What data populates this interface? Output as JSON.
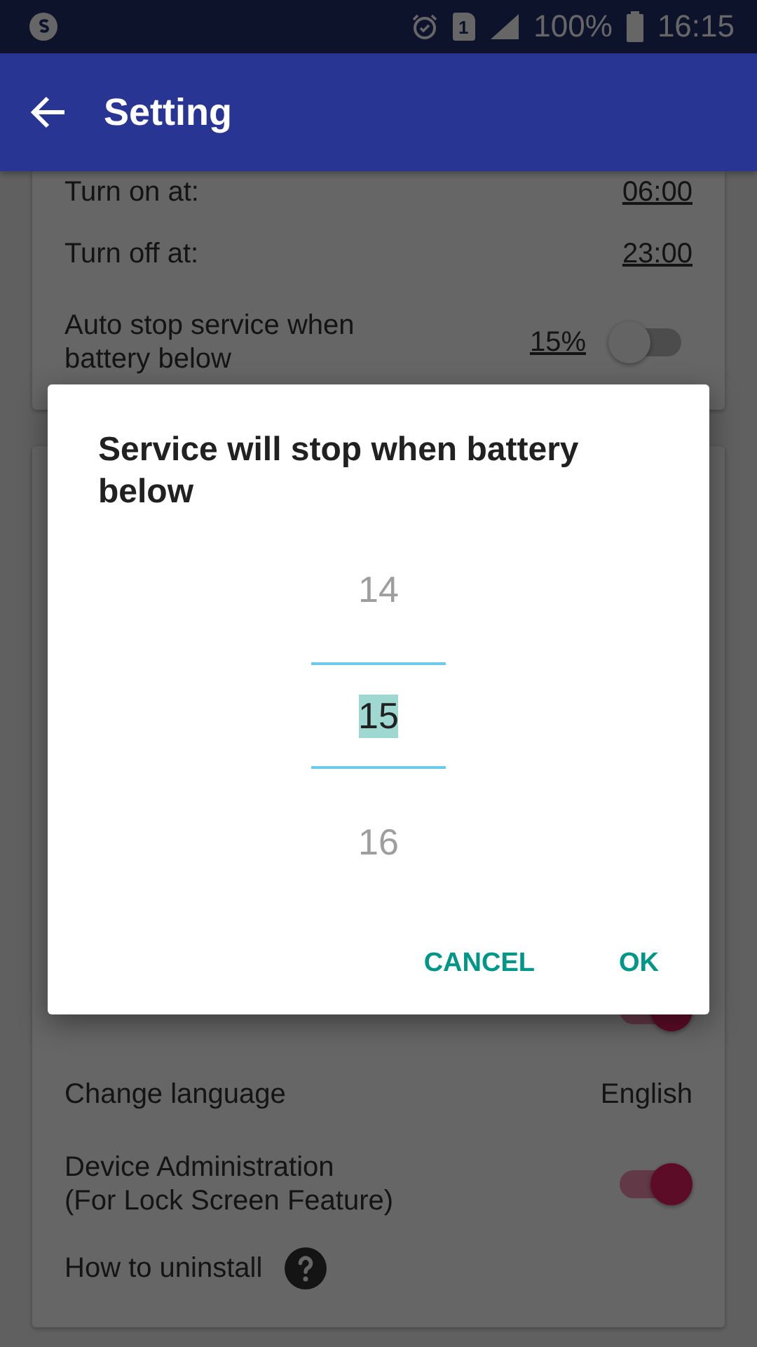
{
  "status_bar": {
    "sim": "1",
    "battery": "100%",
    "time": "16:15"
  },
  "app_bar": {
    "title": "Setting"
  },
  "schedule": [
    {
      "kind": "time",
      "label": "Turn on at:",
      "value": "06:00"
    },
    {
      "kind": "time",
      "label": "Turn off at:",
      "value": "23:00"
    },
    {
      "kind": "toggle",
      "label": "Auto stop service when\n battery below",
      "value": "15%",
      "on": false
    }
  ],
  "options": [
    {
      "kind": "toggle",
      "on": true
    },
    {
      "kind": "choice",
      "label": "Change language",
      "value": "English"
    },
    {
      "kind": "toggle",
      "label": "Device Administration\n (For Lock Screen Feature)",
      "on": true
    },
    {
      "kind": "help",
      "label": "How to uninstall"
    }
  ],
  "dialog": {
    "title": "Service will stop when battery below",
    "picker": [
      {
        "value": "14",
        "selected": false
      },
      {
        "value": "15",
        "selected": true
      },
      {
        "value": "16",
        "selected": false
      }
    ],
    "buttons": [
      "CANCEL",
      "OK"
    ]
  }
}
